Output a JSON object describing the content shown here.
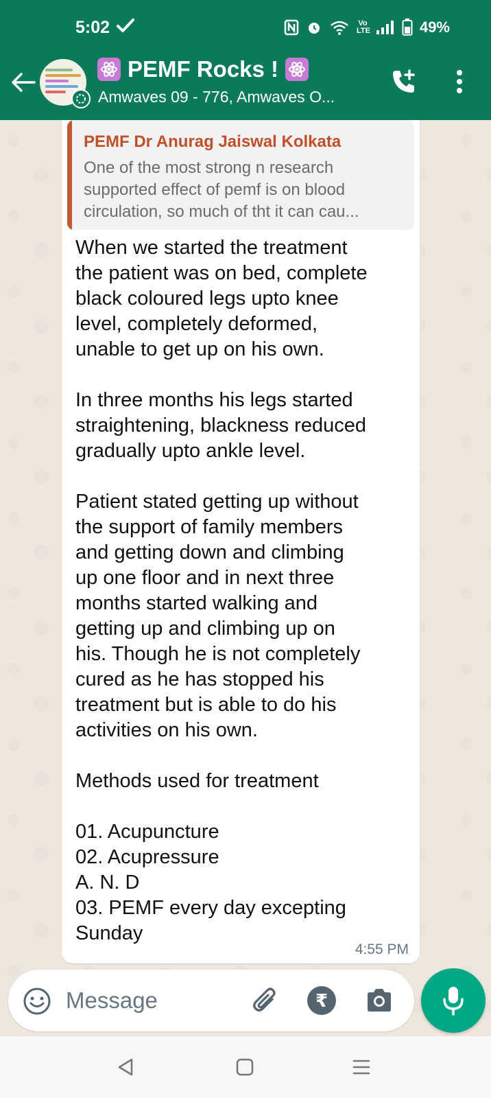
{
  "status_bar": {
    "time": "5:02",
    "battery": "49%",
    "network": "Vo LTE"
  },
  "header": {
    "title": "PEMF Rocks !",
    "subtitle": "Amwaves 09 - 776, Amwaves O..."
  },
  "message": {
    "quoted_author": "PEMF Dr Anurag Jaiswal Kolkata",
    "quoted_lines": [
      "One of the most strong n research",
      "supported effect of pemf is on blood",
      "circulation, so much of tht it can cau..."
    ],
    "lines": [
      "When we started the treatment",
      "the patient was on bed, complete",
      "black coloured legs upto knee",
      "level, completely deformed,",
      "unable to get up on his own.",
      "",
      "In three months his legs started",
      "straightening, blackness reduced",
      "gradually upto ankle level.",
      "",
      "Patient stated getting up without",
      "the support of family members",
      "and getting down and climbing",
      "up one floor and in next three",
      "months started walking and",
      "getting up and climbing up on",
      "his. Though he is not completely",
      "cured as he has stopped his",
      "treatment but is able to do his",
      "activities on his own.",
      "",
      "Methods used for treatment",
      "",
      "01. Acupuncture",
      "02. Acupressure",
      "A. N. D",
      "03. PEMF every day excepting",
      "Sunday"
    ],
    "time": "4:55 PM"
  },
  "composer": {
    "placeholder": "Message",
    "rupee_symbol": "₹"
  },
  "colors": {
    "header_green": "#0b7a5a",
    "chat_bg": "#efe7de",
    "mic_green": "#00a884",
    "quote_author": "#c0502a"
  },
  "icons": {
    "back": "arrow-left-icon",
    "add_call": "phone-plus-icon",
    "more": "more-vertical-icon",
    "emoji": "smiley-icon",
    "attach": "paperclip-icon",
    "rupee": "rupee-icon",
    "camera": "camera-icon",
    "mic": "microphone-icon"
  }
}
